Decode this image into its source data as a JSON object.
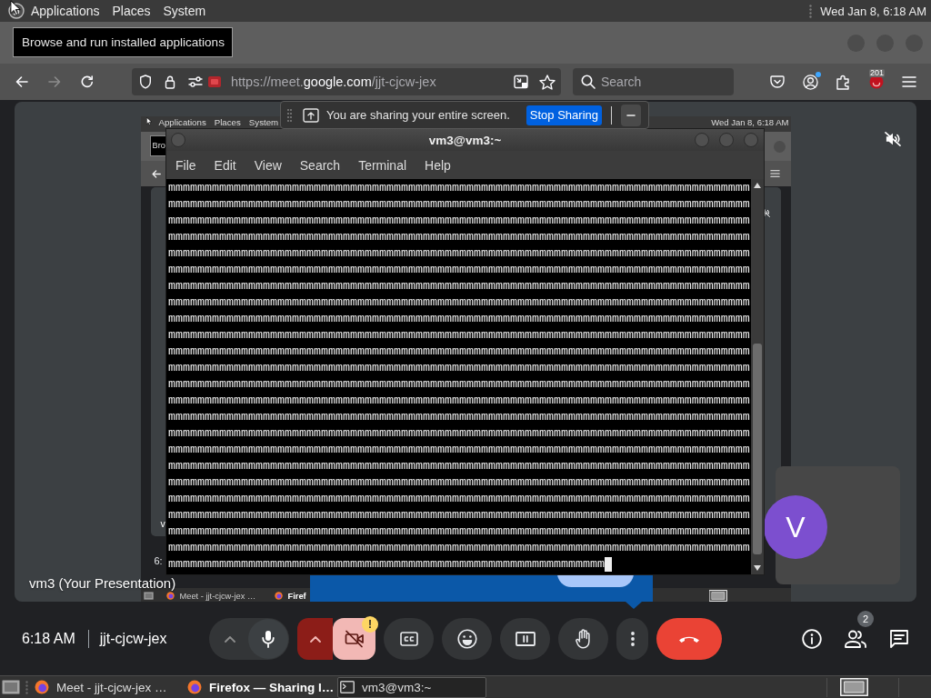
{
  "top_panel": {
    "menus": [
      "Applications",
      "Places",
      "System"
    ],
    "clock": "Wed Jan 8, 6:18 AM"
  },
  "tooltip": "Browse and run installed applications",
  "browser": {
    "url": "https://meet.**google.com**/jjt-cjcw-jex",
    "search": {
      "placeholder": "Search"
    },
    "extension_badge": "201"
  },
  "sharing_bar": {
    "message": "You are sharing your entire screen.",
    "stop_button": "Stop Sharing"
  },
  "meet": {
    "shared_screen": {
      "panel_menus": [
        "Applications",
        "Places",
        "System"
      ],
      "panel_clock": "Wed Jan 8, 6:18 AM",
      "tooltip": "Bro",
      "presentation_label": "v",
      "time": "6:",
      "taskbar": [
        {
          "label": "Meet - jjt-cjcw-jex …",
          "attention": false
        },
        {
          "label": "Firef",
          "attention": true
        }
      ]
    },
    "presentation_label": "vm3 (Your Presentation)",
    "participant": {
      "initial": "V"
    },
    "time": "6:18 AM",
    "meeting_code": "jjt-cjcw-jex",
    "controls": [
      {
        "kind": "mic",
        "on": true
      },
      {
        "kind": "camera",
        "on": false,
        "badge": "!"
      },
      {
        "kind": "captions"
      },
      {
        "kind": "emoji"
      },
      {
        "kind": "present"
      },
      {
        "kind": "raise_hand"
      },
      {
        "kind": "more"
      },
      {
        "kind": "leave"
      }
    ],
    "side_buttons": [
      {
        "kind": "info"
      },
      {
        "kind": "people",
        "badge": "2"
      },
      {
        "kind": "chat"
      }
    ]
  },
  "terminal": {
    "title": "vm3@vm3:~",
    "menu": [
      "File",
      "Edit",
      "View",
      "Search",
      "Terminal",
      "Help"
    ],
    "lines": [
      "mmmmmmmmmmmmmmmmmmmmmmmmmmmmmmmmmmmmmmmmmmmmmmmmmmmmmmmmmmmmmmmmmmmmmmmmmmmmmmmm",
      "mmmmmmmmmmmmmmmmmmmmmmmmmmmmmmmmmmmmmmmmmmmmmmmmmmmmmmmmmmmmmmmmmmmmmmmmmmmmmmmm",
      "mmmmmmmmmmmmmmmmmmmmmmmmmmmmmmmmmmmmmmmmmmmmmmmmmmmmmmmmmmmmmmmmmmmmmmmmmmmmmmmm",
      "mmmmmmmmmmmmmmmmmmmmmmmmmmmmmmmmmmmmmmmmmmmmmmmmmmmmmmmmmmmmmmmmmmmmmmmmmmmmmmmm",
      "mmmmmmmmmmmmmmmmmmmmmmmmmmmmmmmmmmmmmmmmmmmmmmmmmmmmmmmmmmmmmmmmmmmmmmmmmmmmmmmm",
      "mmmmmmmmmmmmmmmmmmmmmmmmmmmmmmmmmmmmmmmmmmmmmmmmmmmmmmmmmmmmmmmmmmmmmmmmmmmmmmmm",
      "mmmmmmmmmmmmmmmmmmmmmmmmmmmmmmmmmmmmmmmmmmmmmmmmmmmmmmmmmmmmmmmmmmmmmmmmmmmmmmmm",
      "mmmmmmmmmmmmmmmmmmmmmmmmmmmmmmmmmmmmmmmmmmmmmmmmmmmmmmmmmmmmmmmmmmmmmmmmmmmmmmmm",
      "mmmmmmmmmmmmmmmmmmmmmmmmmmmmmmmmmmmmmmmmmmmmmmmmmmmmmmmmmmmmmmmmmmmmmmmmmmmmmmmm",
      "mmmmmmmmmmmmmmmmmmmmmmmmmmmmmmmmmmmmmmmmmmmmmmmmmmmmmmmmmmmmmmmmmmmmmmmmmmmmmmmm",
      "mmmmmmmmmmmmmmmmmmmmmmmmmmmmmmmmmmmmmmmmmmmmmmmmmmmmmmmmmmmmmmmmmmmmmmmmmmmmmmmm",
      "mmmmmmmmmmmmmmmmmmmmmmmmmmmmmmmmmmmmmmmmmmmmmmmmmmmmmmmmmmmmmmmmmmmmmmmmmmmmmmmm",
      "mmmmmmmmmmmmmmmmmmmmmmmmmmmmmmmmmmmmmmmmmmmmmmmmmmmmmmmmmmmmmmmmmmmmmmmmmmmmmmmm",
      "mmmmmmmmmmmmmmmmmmmmmmmmmmmmmmmmmmmmmmmmmmmmmmmmmmmmmmmmmmmmmmmmmmmmmmmmmmmmmmmm",
      "mmmmmmmmmmmmmmmmmmmmmmmmmmmmmmmmmmmmmmmmmmmmmmmmmmmmmmmmmmmmmmmmmmmmmmmmmmmmmmmm",
      "mmmmmmmmmmmmmmmmmmmmmmmmmmmmmmmmmmmmmmmmmmmmmmmmmmmmmmmmmmmmmmmmmmmmmmmmmmmmmmmm",
      "mmmmmmmmmmmmmmmmmmmmmmmmmmmmmmmmmmmmmmmmmmmmmmmmmmmmmmmmmmmmmmmmmmmmmmmmmmmmmmmm",
      "mmmmmmmmmmmmmmmmmmmmmmmmmmmmmmmmmmmmmmmmmmmmmmmmmmmmmmmmmmmmmmmmmmmmmmmmmmmmmmmm",
      "mmmmmmmmmmmmmmmmmmmmmmmmmmmmmmmmmmmmmmmmmmmmmmmmmmmmmmmmmmmmmmmmmmmmmmmmmmmmmmmm",
      "mmmmmmmmmmmmmmmmmmmmmmmmmmmmmmmmmmmmmmmmmmmmmmmmmmmmmmmmmmmmmmmmmmmmmmmmmmmmmmmm",
      "mmmmmmmmmmmmmmmmmmmmmmmmmmmmmmmmmmmmmmmmmmmmmmmmmmmmmmmmmmmmmmmmmmmmmmmmmmmmmmmm",
      "mmmmmmmmmmmmmmmmmmmmmmmmmmmmmmmmmmmmmmmmmmmmmmmmmmmmmmmmmmmmmmmmmmmmmmmmmmmmmmmm",
      "mmmmmmmmmmmmmmmmmmmmmmmmmmmmmmmmmmmmmmmmmmmmmmmmmmmmmmmmmmmmmmmmmmmmmmmmmmmmmmmm",
      "mmmmmmmmmmmmmmmmmmmmmmmmmmmmmmmmmmmmmmmmmmmmmmmmmmmmmmmmmmmm"
    ]
  },
  "taskbar": {
    "items": [
      {
        "kind": "browser",
        "label": "Meet - jjt-cjcw-jex …",
        "selected": false,
        "attention": false
      },
      {
        "kind": "browser",
        "label": "Firefox — Sharing I…",
        "selected": false,
        "attention": true
      },
      {
        "kind": "terminal",
        "label": "vm3@vm3:~",
        "selected": true,
        "attention": false
      }
    ]
  }
}
